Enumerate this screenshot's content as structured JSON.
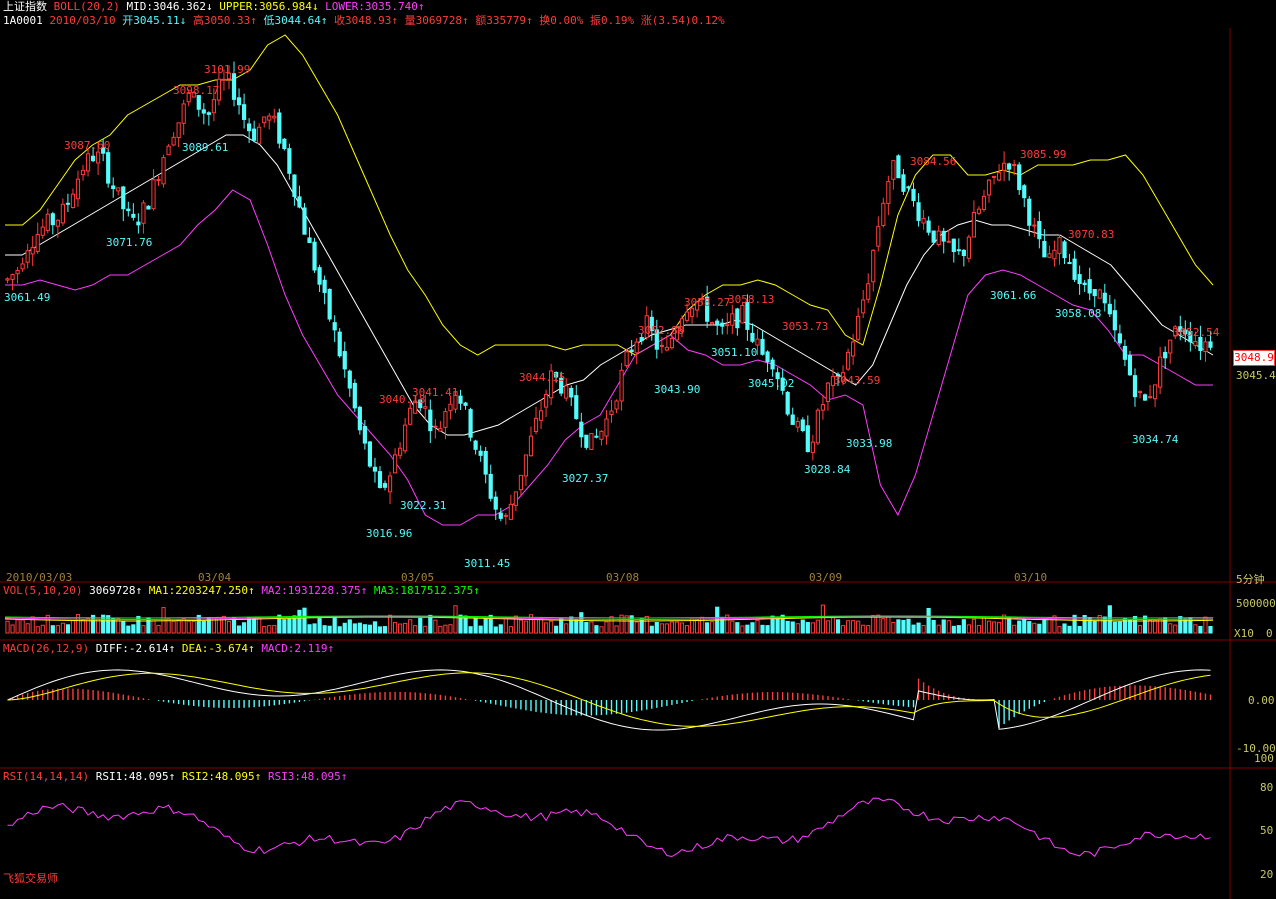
{
  "header": {
    "index_name": "上证指数",
    "boll_label": "BOLL(20,2)",
    "mid": "MID:3046.362↓",
    "upper": "UPPER:3056.984↓",
    "lower": "LOWER:3035.740↑",
    "code": "1A0001",
    "date": "2010/03/10",
    "open": "开3045.11↓",
    "high": "高3050.33↑",
    "low": "低3044.64↑",
    "close": "收3048.93↑",
    "volume": "量3069728↑",
    "amount": "额335779↑",
    "turnover": "换0.00%",
    "amplitude": "振0.19%",
    "change": "涨(3.54)0.12%"
  },
  "price_axis": {
    "current": "3048.9",
    "mid_value": "3045.4"
  },
  "dates": [
    "2010/03/03",
    "03/04",
    "03/05",
    "03/08",
    "03/09",
    "03/10"
  ],
  "period": "5分钟",
  "vol": {
    "label": "VOL(5,10,20)",
    "value": "3069728↑",
    "ma1": "MA1:2203247.250↑",
    "ma2": "MA2:1931228.375↑",
    "ma3": "MA3:1817512.375↑",
    "axis_top": "500000",
    "axis_unit": "X10",
    "axis_zero": "0"
  },
  "macd": {
    "label": "MACD(26,12,9)",
    "diff": "DIFF:-2.614↑",
    "dea": "DEA:-3.674↑",
    "macd": "MACD:2.119↑",
    "axis_zero": "0.00",
    "axis_low": "-10.00"
  },
  "rsi": {
    "label": "RSI(14,14,14)",
    "rsi1": "RSI1:48.095↑",
    "rsi2": "RSI2:48.095↑",
    "rsi3": "RSI3:48.095↑",
    "axis": [
      "100",
      "80",
      "50",
      "20"
    ]
  },
  "brand": "飞狐交易师",
  "colors": {
    "up": "#ff3b3b",
    "down": "#54fcfc",
    "mid": "#ffffff",
    "upper": "#ffff00",
    "lower": "#ff3cff"
  },
  "chart_data": {
    "type": "candlestick",
    "title": "上证指数 5分钟",
    "x": [
      "2010/03/03",
      "03/04",
      "03/05",
      "03/08",
      "03/09",
      "03/10"
    ],
    "ylim": [
      3005,
      3110
    ],
    "price_labels": [
      {
        "text": "3061.49",
        "kind": "low"
      },
      {
        "text": "3071.76",
        "kind": "low"
      },
      {
        "text": "3087.60",
        "kind": "high"
      },
      {
        "text": "3098.17",
        "kind": "high"
      },
      {
        "text": "3101.99",
        "kind": "high"
      },
      {
        "text": "3089.61",
        "kind": "low"
      },
      {
        "text": "3016.96",
        "kind": "low"
      },
      {
        "text": "3040.18",
        "kind": "high"
      },
      {
        "text": "3022.31",
        "kind": "low"
      },
      {
        "text": "3041.41",
        "kind": "high"
      },
      {
        "text": "3011.45",
        "kind": "low"
      },
      {
        "text": "3044.15",
        "kind": "high"
      },
      {
        "text": "3027.37",
        "kind": "low"
      },
      {
        "text": "3052.88",
        "kind": "high"
      },
      {
        "text": "3043.90",
        "kind": "low"
      },
      {
        "text": "3058.27",
        "kind": "high"
      },
      {
        "text": "3058.13",
        "kind": "high"
      },
      {
        "text": "3051.10",
        "kind": "low"
      },
      {
        "text": "3053.73",
        "kind": "high"
      },
      {
        "text": "3045.02",
        "kind": "low"
      },
      {
        "text": "3043.59",
        "kind": "high"
      },
      {
        "text": "3028.84",
        "kind": "low"
      },
      {
        "text": "3033.98",
        "kind": "low"
      },
      {
        "text": "3084.56",
        "kind": "high"
      },
      {
        "text": "3085.99",
        "kind": "high"
      },
      {
        "text": "3061.66",
        "kind": "low"
      },
      {
        "text": "3070.83",
        "kind": "high"
      },
      {
        "text": "3058.08",
        "kind": "low"
      },
      {
        "text": "3052.54",
        "kind": "high"
      },
      {
        "text": "3034.74",
        "kind": "low"
      }
    ],
    "close_series": [
      3061,
      3063,
      3068,
      3070,
      3072,
      3073,
      3075,
      3080,
      3084,
      3086,
      3085,
      3080,
      3076,
      3072,
      3074,
      3078,
      3084,
      3090,
      3093,
      3098,
      3096,
      3094,
      3099,
      3101,
      3098,
      3092,
      3090,
      3094,
      3092,
      3087,
      3080,
      3072,
      3065,
      3058,
      3052,
      3045,
      3038,
      3030,
      3024,
      3018,
      3022,
      3028,
      3034,
      3038,
      3034,
      3030,
      3036,
      3040,
      3034,
      3028,
      3022,
      3016,
      3012,
      3018,
      3024,
      3030,
      3036,
      3042,
      3040,
      3036,
      3032,
      3028,
      3030,
      3034,
      3040,
      3046,
      3050,
      3052,
      3048,
      3046,
      3052,
      3056,
      3057,
      3055,
      3052,
      3050,
      3053,
      3054,
      3050,
      3046,
      3046,
      3040,
      3034,
      3030,
      3028,
      3034,
      3040,
      3040,
      3046,
      3052,
      3060,
      3070,
      3080,
      3084,
      3080,
      3076,
      3073,
      3070,
      3068,
      3066,
      3066,
      3072,
      3076,
      3080,
      3084,
      3085,
      3080,
      3074,
      3068,
      3064,
      3068,
      3066,
      3062,
      3058,
      3060,
      3055,
      3050,
      3045,
      3040,
      3036,
      3040,
      3046,
      3050,
      3052,
      3050,
      3048,
      3049
    ],
    "upper_series": [
      3072,
      3072,
      3075,
      3080,
      3085,
      3088,
      3090,
      3094,
      3096,
      3098,
      3100,
      3100,
      3101,
      3101,
      3103,
      3108,
      3110,
      3106,
      3100,
      3094,
      3086,
      3078,
      3070,
      3063,
      3058,
      3052,
      3048,
      3046,
      3048,
      3048,
      3048,
      3048,
      3047,
      3048,
      3048,
      3048,
      3046,
      3048,
      3050,
      3055,
      3058,
      3060,
      3060,
      3061,
      3060,
      3058,
      3056,
      3055,
      3050,
      3048,
      3060,
      3074,
      3082,
      3086,
      3086,
      3082,
      3082,
      3083,
      3082,
      3084,
      3084,
      3084,
      3085,
      3085,
      3086,
      3082,
      3076,
      3070,
      3064,
      3060
    ],
    "mid_series": [
      3066,
      3066,
      3068,
      3070,
      3072,
      3074,
      3076,
      3078,
      3080,
      3082,
      3084,
      3086,
      3088,
      3090,
      3090,
      3088,
      3084,
      3078,
      3072,
      3066,
      3060,
      3054,
      3048,
      3042,
      3036,
      3032,
      3030,
      3030,
      3031,
      3032,
      3034,
      3036,
      3038,
      3040,
      3041,
      3044,
      3046,
      3048,
      3050,
      3051,
      3052,
      3052,
      3052,
      3053,
      3052,
      3050,
      3048,
      3046,
      3044,
      3042,
      3040,
      3044,
      3052,
      3060,
      3066,
      3070,
      3072,
      3073,
      3072,
      3072,
      3071,
      3070,
      3070,
      3068,
      3066,
      3064,
      3060,
      3056,
      3052,
      3050,
      3048,
      3046
    ]
  }
}
